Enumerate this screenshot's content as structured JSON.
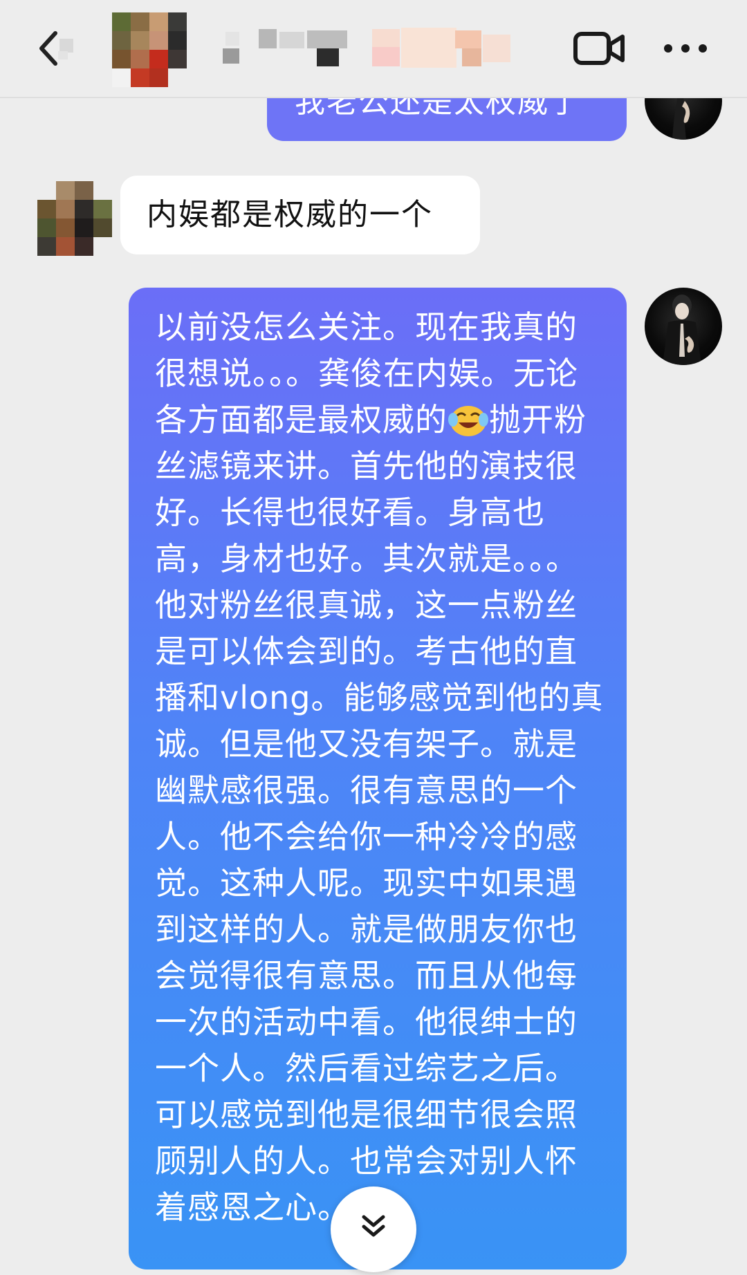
{
  "header": {
    "back_icon": "chevron-left-icon",
    "contact_name": "",
    "video_call_icon": "video-camera-icon",
    "more_icon": "more-dots-icon"
  },
  "messages": [
    {
      "side": "right",
      "text": "我老公还是太权威了"
    },
    {
      "side": "left",
      "text": "内娱都是权威的一个"
    },
    {
      "side": "right",
      "text_before_emoji": "以前没怎么关注。现在我真的很想说。。。龚俊在内娱。无论各方面都是最权威的",
      "emoji": "crying-laughing-emoji",
      "text_after_emoji": "抛开粉丝滤镜来讲。首先他的演技很好。长得也很好看。身高也高，身材也好。其次就是。。。他对粉丝很真诚，这一点粉丝是可以体会到的。考古他的直播和vlong。能够感觉到他的真诚。但是他又没有架子。就是幽默感很强。很有意思的一个人。他不会给你一种冷冷的感觉。这种人呢。现实中如果遇到这样的人。就是做朋友你也会觉得很有意思。而且从他每一次的活动中看。他很绅士的一个人。然后看过综艺之后。可以感觉到他是很细节很会照顾别人的人。也常会对别人怀着感恩之心。"
    }
  ],
  "scroll_down_icon": "double-chevron-down-icon",
  "colors": {
    "background": "#ededed",
    "bubble_self_top": "#6b6ef7",
    "bubble_self_bottom": "#3993f5",
    "bubble_other": "#ffffff"
  }
}
